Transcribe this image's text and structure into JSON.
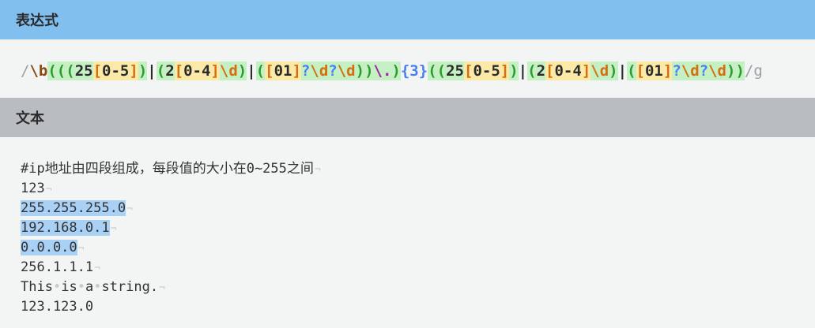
{
  "expression_section": {
    "title": "表达式",
    "tokens": [
      {
        "t": "/",
        "c": "c-delim"
      },
      {
        "t": "\\b",
        "c": "c-esc"
      },
      {
        "t": "(",
        "c": "c-paren",
        "h": "hl-green"
      },
      {
        "t": "(",
        "c": "c-paren",
        "h": "hl-green"
      },
      {
        "t": "(",
        "c": "c-paren",
        "h": "hl-green"
      },
      {
        "t": "25",
        "c": "c-num",
        "h": "hl-green"
      },
      {
        "t": "[",
        "c": "c-set",
        "h": "hl-yellow"
      },
      {
        "t": "0-5",
        "c": "c-num",
        "h": "hl-yellow"
      },
      {
        "t": "]",
        "c": "c-set",
        "h": "hl-yellow"
      },
      {
        "t": ")",
        "c": "c-paren",
        "h": "hl-green"
      },
      {
        "t": "|",
        "c": "c-pipe"
      },
      {
        "t": "(",
        "c": "c-paren",
        "h": "hl-green"
      },
      {
        "t": "2",
        "c": "c-num",
        "h": "hl-green"
      },
      {
        "t": "[",
        "c": "c-set",
        "h": "hl-yellow"
      },
      {
        "t": "0-4",
        "c": "c-num",
        "h": "hl-yellow"
      },
      {
        "t": "]",
        "c": "c-set",
        "h": "hl-yellow"
      },
      {
        "t": "\\d",
        "c": "c-set",
        "h": "hl-green"
      },
      {
        "t": ")",
        "c": "c-paren",
        "h": "hl-green"
      },
      {
        "t": "|",
        "c": "c-pipe"
      },
      {
        "t": "(",
        "c": "c-paren",
        "h": "hl-green"
      },
      {
        "t": "[",
        "c": "c-set",
        "h": "hl-yellow"
      },
      {
        "t": "01",
        "c": "c-num",
        "h": "hl-yellow"
      },
      {
        "t": "]",
        "c": "c-set",
        "h": "hl-yellow"
      },
      {
        "t": "?",
        "c": "c-quant",
        "h": "hl-green"
      },
      {
        "t": "\\d",
        "c": "c-set",
        "h": "hl-green"
      },
      {
        "t": "?",
        "c": "c-quant",
        "h": "hl-green"
      },
      {
        "t": "\\d",
        "c": "c-set",
        "h": "hl-green"
      },
      {
        "t": ")",
        "c": "c-paren",
        "h": "hl-green"
      },
      {
        "t": ")",
        "c": "c-paren",
        "h": "hl-green"
      },
      {
        "t": "\\.",
        "c": "c-dot",
        "h": "hl-green"
      },
      {
        "t": ")",
        "c": "c-paren",
        "h": "hl-green"
      },
      {
        "t": "{3}",
        "c": "c-quant"
      },
      {
        "t": "(",
        "c": "c-paren",
        "h": "hl-green"
      },
      {
        "t": "(",
        "c": "c-paren",
        "h": "hl-green"
      },
      {
        "t": "25",
        "c": "c-num",
        "h": "hl-green"
      },
      {
        "t": "[",
        "c": "c-set",
        "h": "hl-yellow"
      },
      {
        "t": "0-5",
        "c": "c-num",
        "h": "hl-yellow"
      },
      {
        "t": "]",
        "c": "c-set",
        "h": "hl-yellow"
      },
      {
        "t": ")",
        "c": "c-paren",
        "h": "hl-green"
      },
      {
        "t": "|",
        "c": "c-pipe"
      },
      {
        "t": "(",
        "c": "c-paren",
        "h": "hl-green"
      },
      {
        "t": "2",
        "c": "c-num",
        "h": "hl-green"
      },
      {
        "t": "[",
        "c": "c-set",
        "h": "hl-yellow"
      },
      {
        "t": "0-4",
        "c": "c-num",
        "h": "hl-yellow"
      },
      {
        "t": "]",
        "c": "c-set",
        "h": "hl-yellow"
      },
      {
        "t": "\\d",
        "c": "c-set",
        "h": "hl-green"
      },
      {
        "t": ")",
        "c": "c-paren",
        "h": "hl-green"
      },
      {
        "t": "|",
        "c": "c-pipe"
      },
      {
        "t": "(",
        "c": "c-paren",
        "h": "hl-green"
      },
      {
        "t": "[",
        "c": "c-set",
        "h": "hl-yellow"
      },
      {
        "t": "01",
        "c": "c-num",
        "h": "hl-yellow"
      },
      {
        "t": "]",
        "c": "c-set",
        "h": "hl-yellow"
      },
      {
        "t": "?",
        "c": "c-quant",
        "h": "hl-green"
      },
      {
        "t": "\\d",
        "c": "c-set",
        "h": "hl-green"
      },
      {
        "t": "?",
        "c": "c-quant",
        "h": "hl-green"
      },
      {
        "t": "\\d",
        "c": "c-set",
        "h": "hl-green"
      },
      {
        "t": ")",
        "c": "c-paren",
        "h": "hl-green"
      },
      {
        "t": ")",
        "c": "c-paren",
        "h": "hl-green"
      },
      {
        "t": "/g",
        "c": "c-delim"
      }
    ]
  },
  "text_section": {
    "title": "文本",
    "lines": [
      {
        "text": "#ip地址由四段组成，每段值的大小在0~255之间",
        "match": false
      },
      {
        "text": "123",
        "match": false
      },
      {
        "text": "255.255.255.0",
        "match": true
      },
      {
        "text": "192.168.0.1",
        "match": true
      },
      {
        "text": "0.0.0.0",
        "match": true
      },
      {
        "text": "256.1.1.1",
        "match": false
      },
      {
        "text": "This is a string.",
        "match": false
      },
      {
        "text": "123.123.0",
        "match": false,
        "noeol": true
      }
    ],
    "eol_marker": "¬",
    "space_marker": "•"
  },
  "colors": {
    "expression_header": "#80bfee",
    "text_header": "#b9bcc0",
    "match_highlight": "#a9d0f5"
  }
}
